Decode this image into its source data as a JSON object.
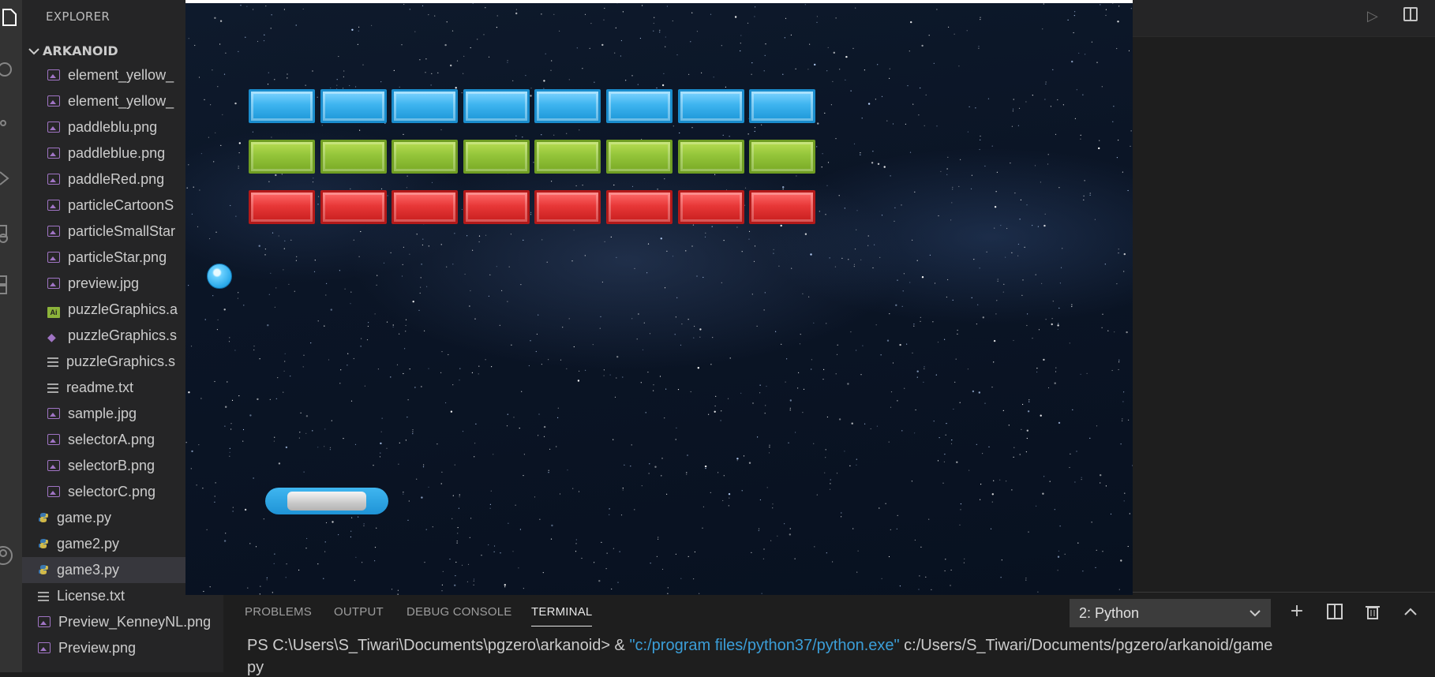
{
  "sidebar": {
    "title": "EXPLORER",
    "section": "ARKANOID",
    "items": [
      {
        "label": "element_yellow_",
        "icon": "image-icon",
        "indent": 2
      },
      {
        "label": "element_yellow_",
        "icon": "image-icon",
        "indent": 2
      },
      {
        "label": "paddleblu.png",
        "icon": "image-icon",
        "indent": 2
      },
      {
        "label": "paddleblue.png",
        "icon": "image-icon",
        "indent": 2
      },
      {
        "label": "paddleRed.png",
        "icon": "image-icon",
        "indent": 2
      },
      {
        "label": "particleCartoonS",
        "icon": "image-icon",
        "indent": 2
      },
      {
        "label": "particleSmallStar",
        "icon": "image-icon",
        "indent": 2
      },
      {
        "label": "particleStar.png",
        "icon": "image-icon",
        "indent": 2
      },
      {
        "label": "preview.jpg",
        "icon": "image-icon",
        "indent": 2
      },
      {
        "label": "puzzleGraphics.a",
        "icon": "ai-icon",
        "indent": 2
      },
      {
        "label": "puzzleGraphics.s",
        "icon": "svg-icon",
        "indent": 2
      },
      {
        "label": "puzzleGraphics.s",
        "icon": "text-icon",
        "indent": 2
      },
      {
        "label": "readme.txt",
        "icon": "text-icon",
        "indent": 2
      },
      {
        "label": "sample.jpg",
        "icon": "image-icon",
        "indent": 2
      },
      {
        "label": "selectorA.png",
        "icon": "image-icon",
        "indent": 2
      },
      {
        "label": "selectorB.png",
        "icon": "image-icon",
        "indent": 2
      },
      {
        "label": "selectorC.png",
        "icon": "image-icon",
        "indent": 2
      },
      {
        "label": "game.py",
        "icon": "python-icon",
        "indent": 1
      },
      {
        "label": "game2.py",
        "icon": "python-icon",
        "indent": 1
      },
      {
        "label": "game3.py",
        "icon": "python-icon",
        "indent": 1,
        "selected": true
      },
      {
        "label": "License.txt",
        "icon": "text-icon",
        "indent": 1
      },
      {
        "label": "Preview_KenneyNL.png",
        "icon": "image-icon",
        "indent": 1
      },
      {
        "label": "Preview.png",
        "icon": "image-icon",
        "indent": 1
      }
    ]
  },
  "panel": {
    "tabs": [
      "PROBLEMS",
      "OUTPUT",
      "DEBUG CONSOLE",
      "TERMINAL"
    ],
    "active_tab": "TERMINAL",
    "terminal_select": "2: Python",
    "terminal_line": {
      "prompt": "PS C:\\Users\\S_Tiwari\\Documents\\pgzero\\arkanoid> & ",
      "string": "\"c:/program files/python37/python.exe\"",
      "rest": " c:/Users/S_Tiwari/Documents/pgzero/arkanoid/game"
    },
    "terminal_line2": "py"
  },
  "game": {
    "rows": [
      {
        "color": "blue",
        "count": 8
      },
      {
        "color": "green",
        "count": 8
      },
      {
        "color": "red",
        "count": 8
      }
    ],
    "colors": {
      "blue": "#3eb4ef",
      "green": "#94c53a",
      "red": "#e83838",
      "paddle": "#1f93d6",
      "ball": "#2aa9ea"
    }
  },
  "icons": {
    "activity": [
      "files-icon",
      "search-icon",
      "source-control-icon",
      "run-debug-icon",
      "remote-explorer-icon",
      "extensions-icon",
      "account-icon"
    ],
    "editor_actions": [
      "run-icon",
      "split-editor-icon"
    ],
    "panel_actions": [
      "add-terminal-icon",
      "split-terminal-icon",
      "kill-terminal-icon",
      "maximize-panel-icon"
    ]
  }
}
